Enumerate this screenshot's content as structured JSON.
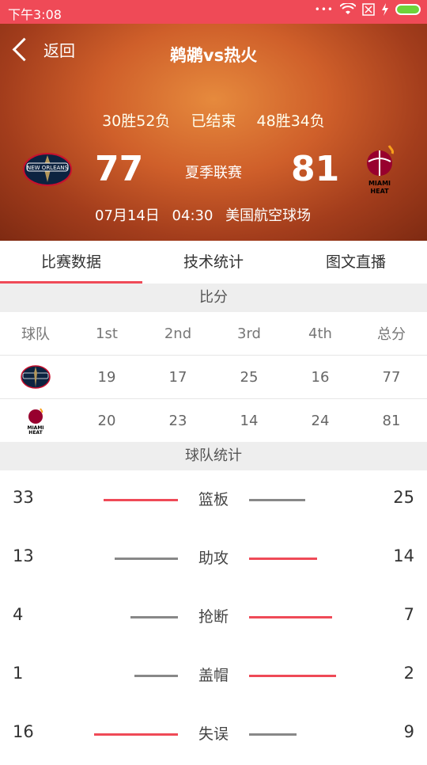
{
  "status_bar": {
    "time": "下午3:08"
  },
  "header": {
    "back_label": "返回",
    "title": "鹈鹕vs热火",
    "home_record": "30胜52负",
    "status": "已结束",
    "away_record": "48胜34负",
    "home_score": "77",
    "away_score": "81",
    "league": "夏季联赛",
    "date": "07月14日",
    "time": "04:30",
    "venue": "美国航空球场",
    "home_logo_icon": "pelicans-logo",
    "away_logo_icon": "heat-logo",
    "home_logo_text": "NEW ORLEANS",
    "away_logo_text": "MIAMI HEAT"
  },
  "tabs": [
    {
      "label": "比赛数据",
      "active": true
    },
    {
      "label": "技术统计",
      "active": false
    },
    {
      "label": "图文直播",
      "active": false
    }
  ],
  "score_section": {
    "title": "比分",
    "columns": [
      "球队",
      "1st",
      "2nd",
      "3rd",
      "4th",
      "总分"
    ],
    "rows": [
      {
        "team_icon": "pelicans-logo",
        "values": [
          "19",
          "17",
          "25",
          "16",
          "77"
        ]
      },
      {
        "team_icon": "heat-logo",
        "values": [
          "20",
          "23",
          "14",
          "24",
          "81"
        ]
      }
    ]
  },
  "team_stats": {
    "title": "球队统计",
    "items": [
      {
        "name": "篮板",
        "left": "33",
        "right": "25"
      },
      {
        "name": "助攻",
        "left": "13",
        "right": "14"
      },
      {
        "name": "抢断",
        "left": "4",
        "right": "7"
      },
      {
        "name": "盖帽",
        "left": "1",
        "right": "2"
      },
      {
        "name": "失误",
        "left": "16",
        "right": "9"
      }
    ]
  },
  "colors": {
    "accent": "#ef4a57",
    "neutral_bar": "#888888",
    "battery": "#6ed33a"
  }
}
